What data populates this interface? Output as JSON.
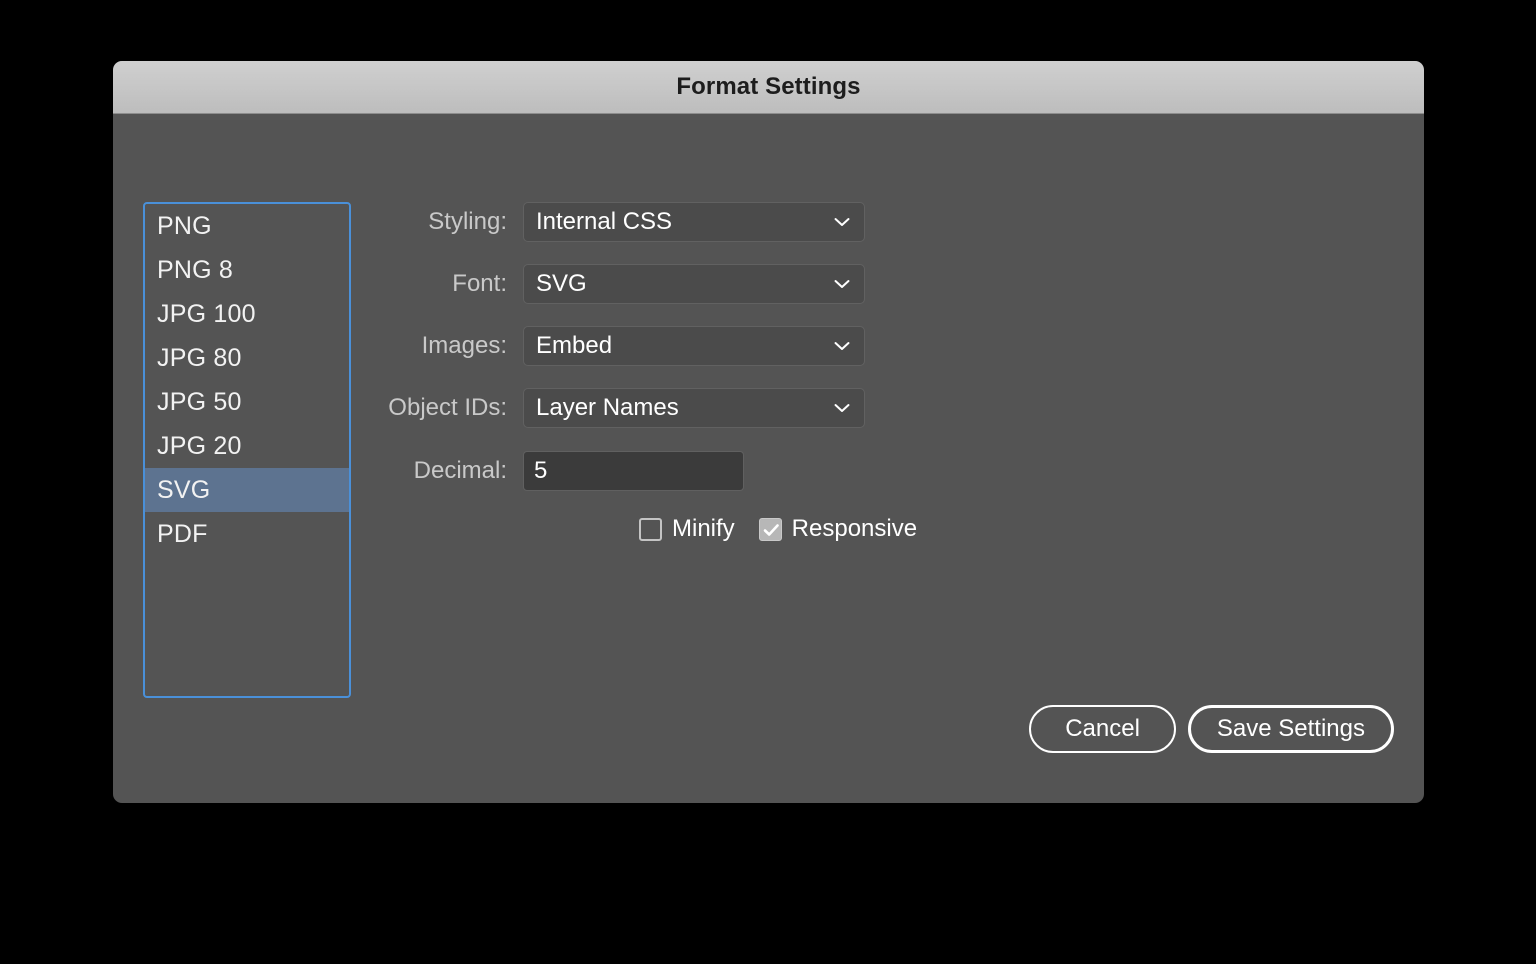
{
  "dialog": {
    "title": "Format Settings"
  },
  "format_list": {
    "name": "format-presets",
    "items": [
      {
        "label": "PNG",
        "selected": false
      },
      {
        "label": "PNG 8",
        "selected": false
      },
      {
        "label": "JPG 100",
        "selected": false
      },
      {
        "label": "JPG 80",
        "selected": false
      },
      {
        "label": "JPG 50",
        "selected": false
      },
      {
        "label": "JPG 20",
        "selected": false
      },
      {
        "label": "SVG",
        "selected": true
      },
      {
        "label": "PDF",
        "selected": false
      }
    ],
    "selected_value": "SVG"
  },
  "form": {
    "styling": {
      "label": "Styling:",
      "value": "Internal CSS"
    },
    "font": {
      "label": "Font:",
      "value": "SVG"
    },
    "images": {
      "label": "Images:",
      "value": "Embed"
    },
    "object_ids": {
      "label": "Object IDs:",
      "value": "Layer Names"
    },
    "decimal": {
      "label": "Decimal:",
      "value": "5"
    }
  },
  "checkboxes": [
    {
      "label": "Minify",
      "checked": false
    },
    {
      "label": "Responsive",
      "checked": true
    }
  ],
  "footer": {
    "cancel_label": "Cancel",
    "save_label": "Save Settings"
  },
  "colors": {
    "dialog_background": "#545454",
    "titlebar": "#c6c6c6",
    "focus_border": "#4a90d9",
    "selection_highlight": "#5d7390",
    "field_background": "#4b4b4b",
    "input_background": "#3b3b3b",
    "label_text": "#c9c9c9",
    "value_text": "#ffffff",
    "page_background": "#000000"
  },
  "icons": {
    "chevron_down": "chevron-down-icon",
    "checkmark": "check-icon"
  }
}
